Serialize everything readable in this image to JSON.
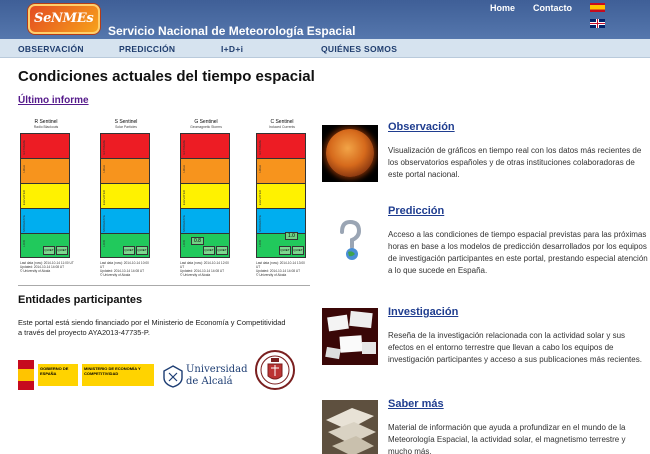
{
  "header": {
    "logo_text": "SeNMEs",
    "site_title": "Servicio Nacional de Meteorología Espacial",
    "nav": {
      "home": "Home",
      "contact": "Contacto"
    },
    "flags": [
      "spain-flag-icon",
      "uk-flag-icon"
    ]
  },
  "menu": {
    "items": [
      {
        "label": "OBSERVACIÓN"
      },
      {
        "label": "PREDICCIÓN"
      },
      {
        "label": "I+D+i"
      },
      {
        "label": "QUIÉNES SOMOS"
      }
    ]
  },
  "main": {
    "title": "Condiciones actuales del tiempo espacial",
    "last_report": "Último informe",
    "sentinels": [
      {
        "name": "R Sentinel",
        "subtitle": "Radio Blackouts",
        "quiet_labels": [
          "QUIET",
          "QUIET"
        ],
        "value": "",
        "foot": "Last data (now): 2014-10-14 11:00 UT\nUpdated: 2014-10-14 14:08 UT\n© University of Alcala"
      },
      {
        "name": "S Sentinel",
        "subtitle": "Solar Particles",
        "quiet_labels": [
          "QUIET",
          "QUIET"
        ],
        "value": "",
        "foot": "Last data (now): 2014-10-14 10:00 UT\nUpdated: 2014-10-14 14:08 UT\n© University of Alcala"
      },
      {
        "name": "G Sentinel",
        "subtitle": "Geomagnetic Storms",
        "quiet_labels": [
          "QUIET",
          "QUIET"
        ],
        "value": "0.8",
        "foot": "Last data (now): 2014-10-14 12:00 UT\nUpdated: 2014-10-14 14:08 UT\n© University of Alcala"
      },
      {
        "name": "C Sentinel",
        "subtitle": "Induced Currents",
        "quiet_labels": [
          "QUIET",
          "QUIET"
        ],
        "value": "1.0",
        "foot": "Last data (now): 2014-10-14 13:00 UT\nUpdated: 2014-10-14 14:08 UT\n© University of Alcala"
      }
    ],
    "band_labels": [
      "EXTREME",
      "HIGH",
      "ELEVATED",
      "MODERATE",
      "LOW"
    ],
    "band_colors": [
      "#ed1c24",
      "#f7941d",
      "#fff200",
      "#00aeef",
      "#21c95c"
    ]
  },
  "entities": {
    "title": "Entidades participantes",
    "text": "Este portal está siendo financiado por el Ministerio de Economía y Competitividad a través del proyecto AYA2013-47735-P.",
    "logos": {
      "gobierno": [
        "GOBIERNO DE ESPAÑA",
        "MINISTERIO DE ECONOMÍA Y COMPETITIVIDAD"
      ],
      "alcala": [
        "Universidad",
        "de Alcalá"
      ],
      "ucm": "ucm-emblem-icon"
    }
  },
  "features": [
    {
      "title": "Observación",
      "text": "Visualización de gráficos en tiempo real con los datos más recientes de los observatorios españoles y de otras instituciones colaboradoras de este portal nacional.",
      "icon": "sun-image"
    },
    {
      "title": "Predicción",
      "text": "Acceso a las condiciones de tiempo espacial previstas para las próximas horas en base a los modelos de predicción desarrollados por los equipos de investigación participantes en este portal, prestando especial atención a lo que sucede en España.",
      "icon": "question-globe-icon"
    },
    {
      "title": "Investigación",
      "text": "Reseña de la investigación relacionada con la actividad solar y sus efectos en el entorno terrestre que llevan a cabo los equipos de investigación participantes y acceso a sus publicaciones más recientes.",
      "icon": "papers-image"
    },
    {
      "title": "Saber más",
      "text": "Material de información que ayuda a profundizar en el mundo de la Meteorología Espacial, la actividad solar, el magnetismo terrestre y mucho más.",
      "icon": "books-image"
    }
  ]
}
